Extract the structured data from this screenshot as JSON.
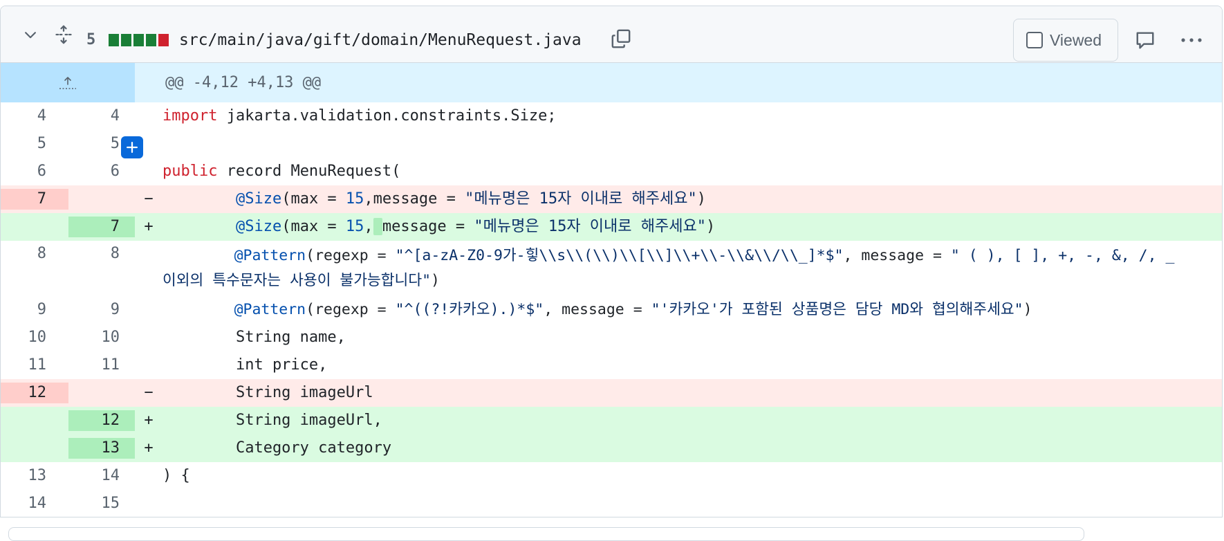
{
  "header": {
    "change_count": "5",
    "diffstat": [
      "#1a7f37",
      "#1a7f37",
      "#1a7f37",
      "#1a7f37",
      "#cf222e"
    ],
    "file_path": "src/main/java/gift/domain/MenuRequest.java",
    "viewed_label": "Viewed"
  },
  "hunk": {
    "header": "@@ -4,12 +4,13 @@"
  },
  "lines": [
    {
      "type": "ctx",
      "old": "4",
      "new": "4",
      "sign": ""
    },
    {
      "type": "ctx",
      "old": "5",
      "new": "5",
      "sign": ""
    },
    {
      "type": "ctx",
      "old": "6",
      "new": "6",
      "sign": ""
    },
    {
      "type": "del",
      "old": "7",
      "new": "",
      "sign": "−"
    },
    {
      "type": "add",
      "old": "",
      "new": "7",
      "sign": "+"
    },
    {
      "type": "ctx",
      "old": "8",
      "new": "8",
      "sign": ""
    },
    {
      "type": "ctx",
      "old": "9",
      "new": "9",
      "sign": ""
    },
    {
      "type": "ctx",
      "old": "10",
      "new": "10",
      "sign": ""
    },
    {
      "type": "ctx",
      "old": "11",
      "new": "11",
      "sign": ""
    },
    {
      "type": "del",
      "old": "12",
      "new": "",
      "sign": "−"
    },
    {
      "type": "add",
      "old": "",
      "new": "12",
      "sign": "+"
    },
    {
      "type": "add",
      "old": "",
      "new": "13",
      "sign": "+"
    },
    {
      "type": "ctx",
      "old": "13",
      "new": "14",
      "sign": ""
    },
    {
      "type": "ctx",
      "old": "14",
      "new": "15",
      "sign": ""
    }
  ],
  "code": {
    "l0_kw": "import",
    "l0_rest": " jakarta.validation.constraints.Size;",
    "l2_kw": "public",
    "l2_rest": " record MenuRequest(",
    "l3_indent": "        ",
    "l3_an": "@Size",
    "l3_a": "(max = ",
    "l3_num": "15",
    "l3_b": ",message = ",
    "l3_str": "\"메뉴명은 15자 이내로 해주세요\"",
    "l3_c": ")",
    "l4_indent": "        ",
    "l4_an": "@Size",
    "l4_a": "(max = ",
    "l4_num": "15",
    "l4_b": ",",
    "l4_hl": " ",
    "l4_c": "message = ",
    "l4_str": "\"메뉴명은 15자 이내로 해주세요\"",
    "l4_d": ")",
    "l5_indent": "        ",
    "l5_an": "@Pattern",
    "l5_a": "(regexp = ",
    "l5_str1": "\"^[a-zA-Z0-9가-힣\\\\s\\\\(\\\\)\\\\[\\\\]\\\\+\\\\-\\\\&\\\\/\\\\_]*$\"",
    "l5_b": ", message = ",
    "l5_str2": "\" ( ), [ ], +, -, &, /, _ 이외의 특수문자는 사용이 불가능합니다\"",
    "l5_c": ")",
    "l6_indent": "        ",
    "l6_an": "@Pattern",
    "l6_a": "(regexp = ",
    "l6_str1": "\"^((?!카카오).)*$\"",
    "l6_b": ", message = ",
    "l6_str2": "\"'카카오'가 포함된 상품명은 담당 MD와 협의해주세요\"",
    "l6_c": ")",
    "l7": "        String name,",
    "l8": "        int price,",
    "l9": "        String imageUrl",
    "l10": "        String imageUrl,",
    "l11": "        Category category",
    "l12": ") {",
    "l13": ""
  }
}
